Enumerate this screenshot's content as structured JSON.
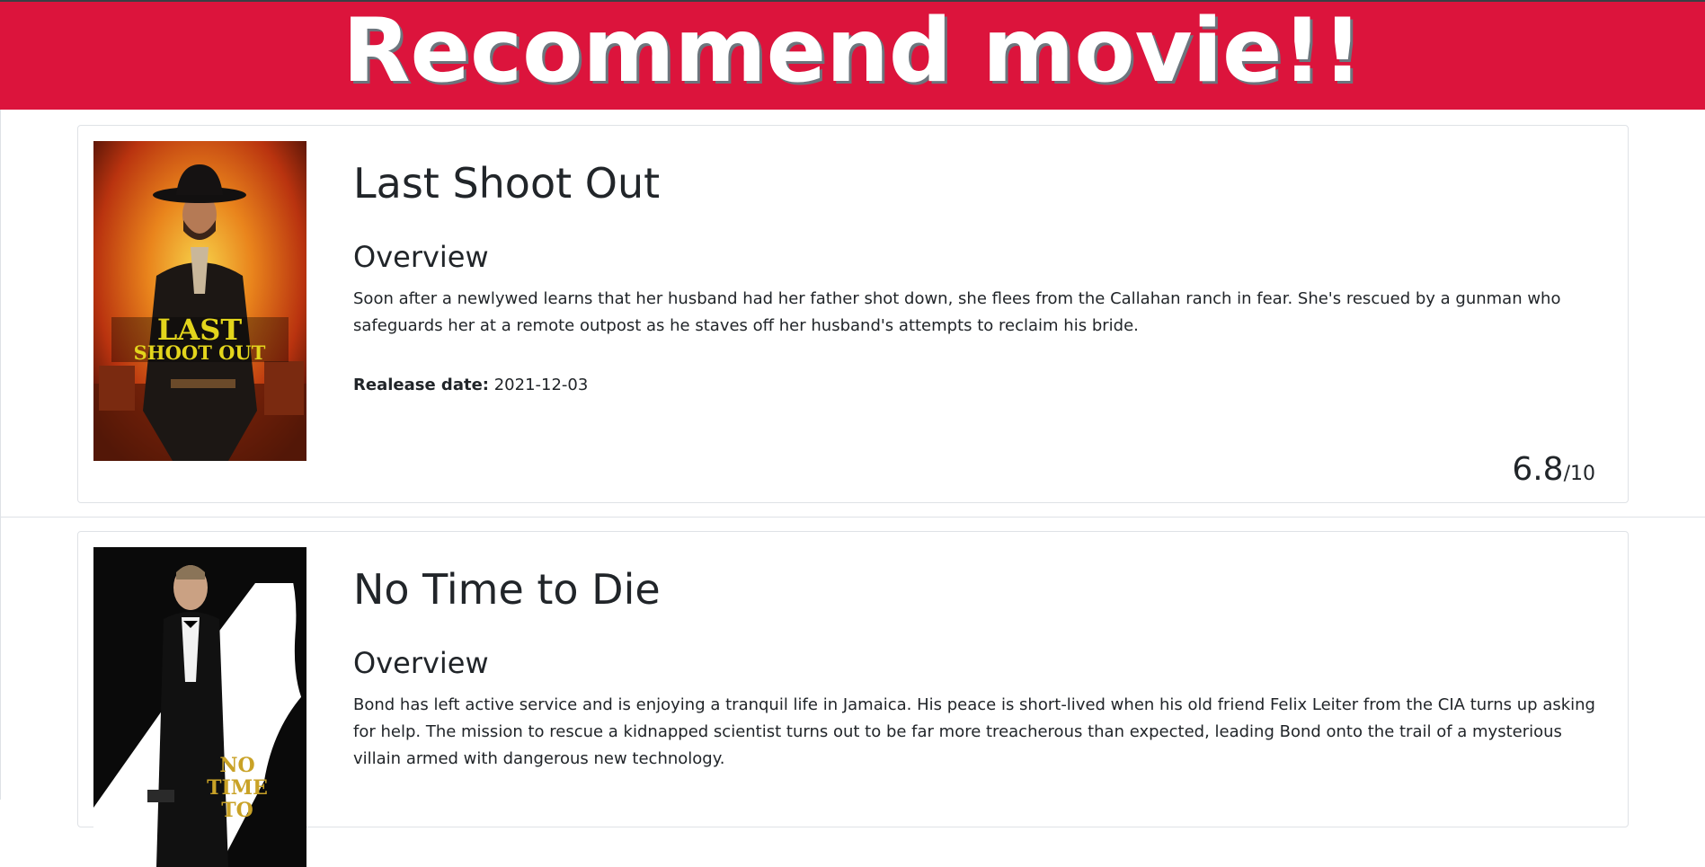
{
  "header": {
    "title": "Recommend movie!!"
  },
  "movies": [
    {
      "title": "Last Shoot Out",
      "overview_heading": "Overview",
      "overview": "Soon after a newlywed learns that her husband had her father shot down, she flees from the Callahan ranch in fear. She's rescued by a gunman who safeguards her at a remote outpost as he staves off her husband's attempts to reclaim his bride.",
      "release_label": "Realease date:",
      "release_date": "2021-12-03",
      "rating": "6.8",
      "rating_suffix": "/10",
      "poster_text": "LAST SHOOT OUT"
    },
    {
      "title": "No Time to Die",
      "overview_heading": "Overview",
      "overview": "Bond has left active service and is enjoying a tranquil life in Jamaica. His peace is short-lived when his old friend Felix Leiter from the CIA turns up asking for help. The mission to rescue a kidnapped scientist turns out to be far more treacherous than expected, leading Bond onto the trail of a mysterious villain armed with dangerous new technology.",
      "poster_text": "NO TIME TO"
    }
  ],
  "colors": {
    "header_bg": "#dc143c",
    "text": "#212529",
    "border": "#dfe2e6"
  }
}
